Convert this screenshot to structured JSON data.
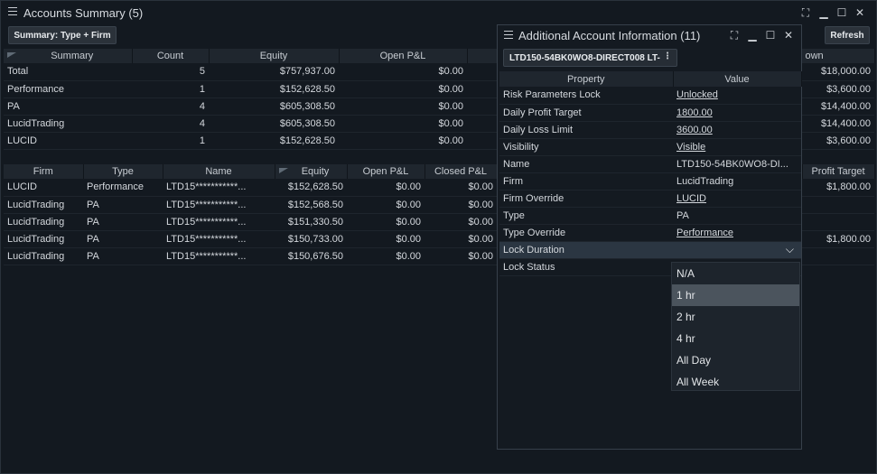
{
  "window": {
    "title": "Accounts Summary (5)",
    "summary_button": "Summary: Type + Firm",
    "refresh_button": "Refresh"
  },
  "summary_table": {
    "headers": [
      "Summary",
      "Count",
      "Equity",
      "Open P&L",
      "",
      "own"
    ],
    "rows": [
      [
        "Total",
        "5",
        "$757,937.00",
        "$0.00",
        "$18,000.00"
      ],
      [
        "Performance",
        "1",
        "$152,628.50",
        "$0.00",
        "$3,600.00"
      ],
      [
        "PA",
        "4",
        "$605,308.50",
        "$0.00",
        "$14,400.00"
      ],
      [
        "LucidTrading",
        "4",
        "$605,308.50",
        "$0.00",
        "$14,400.00"
      ],
      [
        "LUCID",
        "1",
        "$152,628.50",
        "$0.00",
        "$3,600.00"
      ]
    ]
  },
  "accounts_table": {
    "headers": [
      "Firm",
      "Type",
      "Name",
      "Equity",
      "Open P&L",
      "Closed P&L",
      "Profit Target"
    ],
    "rows": [
      [
        "LUCID",
        "Performance",
        "LTD15***********...",
        "$152,628.50",
        "$0.00",
        "$0.00",
        "$1,800.00"
      ],
      [
        "LucidTrading",
        "PA",
        "LTD15***********...",
        "$152,568.50",
        "$0.00",
        "$0.00",
        ""
      ],
      [
        "LucidTrading",
        "PA",
        "LTD15***********...",
        "$151,330.50",
        "$0.00",
        "$0.00",
        ""
      ],
      [
        "LucidTrading",
        "PA",
        "LTD15***********...",
        "$150,733.00",
        "$0.00",
        "$0.00",
        "$1,800.00"
      ],
      [
        "LucidTrading",
        "PA",
        "LTD15***********...",
        "$150,676.50",
        "$0.00",
        "$0.00",
        ""
      ]
    ]
  },
  "panel": {
    "title": "Additional Account Information (11)",
    "account_selector": "LTD150-54BK0WO8-DIRECT008 LT-",
    "headers": [
      "Property",
      "Value"
    ],
    "rows": [
      [
        "Risk Parameters Lock",
        "Unlocked"
      ],
      [
        "Daily Profit Target",
        "1800.00"
      ],
      [
        "Daily Loss Limit",
        "3600.00"
      ],
      [
        "Visibility",
        "Visible"
      ],
      [
        "Name",
        "LTD150-54BK0WO8-DI..."
      ],
      [
        "Firm",
        "LucidTrading"
      ],
      [
        "Firm Override",
        "LUCID"
      ],
      [
        "Type",
        "PA"
      ],
      [
        "Type Override",
        "Performance"
      ],
      [
        "Lock Duration",
        ""
      ],
      [
        "Lock Status",
        ""
      ]
    ]
  },
  "dropdown": {
    "options": [
      "N/A",
      "1 hr",
      "2 hr",
      "4 hr",
      "All Day",
      "All Week"
    ],
    "selected": "1 hr"
  },
  "colors": {
    "negative": "#e05a5a",
    "positive": "#3fbf6a"
  }
}
